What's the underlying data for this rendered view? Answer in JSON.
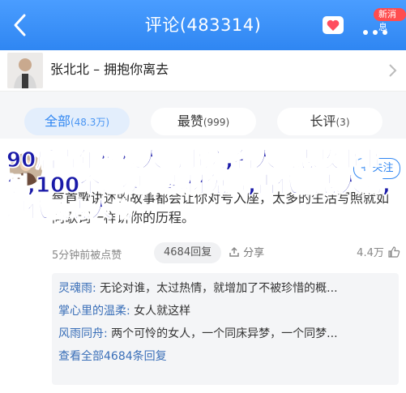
{
  "header": {
    "title": "评论(483314)",
    "badge": "新消息"
  },
  "song": {
    "text": "张北北 – 拥抱你离去"
  },
  "sort_tabs": [
    {
      "label": "全部",
      "count": "(48.3万)"
    },
    {
      "label": "最赞",
      "count": "(999)"
    },
    {
      "label": "长评",
      "count": "(3)"
    }
  ],
  "comment": {
    "follow": "+ 关注",
    "overlay_title": "90后青年楷模人物事迹,名人励志故事事例,100个短视频素材免费,古代励志人物,现代励志人物",
    "text": "每首歌讲述的故事都会让你对号入座，太多的生活写照就如同歌词一样讲你的历程。",
    "time": "5分钟前被点赞",
    "reply_count": "4684回复",
    "share_label": "分享",
    "likes": "4.4万"
  },
  "replies": [
    {
      "name": "灵魂雨:",
      "text": "无论对谁，太过热情，就增加了不被珍惜的概..."
    },
    {
      "name": "掌心里的温柔:",
      "text": "女人就这样"
    },
    {
      "name": "风雨同舟:",
      "text": "两个可怜的女人，一个同床异梦，一个同梦..."
    }
  ],
  "view_all": "查看全部4684条回复",
  "colors": {
    "brand": "#2f86f2",
    "header_bg": "#4a9dff",
    "overlay": "#1a1aa8"
  }
}
